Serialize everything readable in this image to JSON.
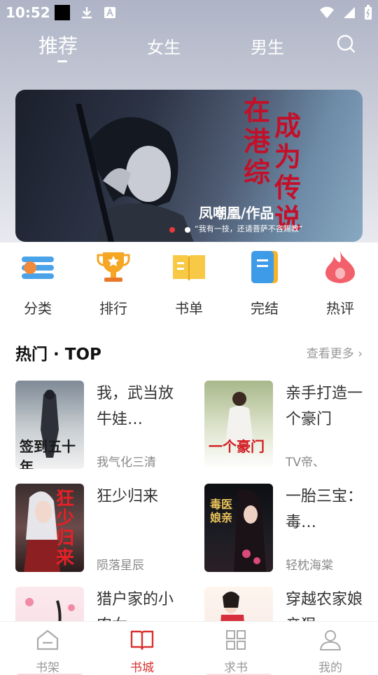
{
  "status_bar": {
    "time": "10:52"
  },
  "top_tabs": [
    "推荐",
    "女生",
    "男生"
  ],
  "banner": {
    "title_col1": "在港综",
    "title_col2": "成为传说",
    "author": "凤嘲凰/作品",
    "slogan": "“我有一技，还请菩萨不吝赐教”"
  },
  "categories": [
    "分类",
    "排行",
    "书单",
    "完结",
    "热评"
  ],
  "hot": {
    "title": "热门 · TOP",
    "more": "查看更多"
  },
  "books": [
    {
      "title": "我，武当放牛娃…",
      "author": "我气化三清",
      "cover_text": "签到五十年"
    },
    {
      "title": "亲手打造一个豪门",
      "author": "TV帝、",
      "cover_text": "一个豪门"
    },
    {
      "title": "狂少归来",
      "author": "陨落星辰",
      "cover_text": "狂少归来"
    },
    {
      "title": "一胎三宝：毒…",
      "author": "轻枕海棠",
      "cover_text": "毒医娘亲"
    },
    {
      "title": "猎户家的小农女",
      "author": "",
      "cover_text": ""
    },
    {
      "title": "穿越农家娘亲狠",
      "author": "",
      "cover_text": ""
    }
  ],
  "bottom_nav": [
    "书架",
    "书城",
    "求书",
    "我的"
  ],
  "colors": {
    "accent": "#d8312f",
    "banner_title": "#c3102a"
  }
}
